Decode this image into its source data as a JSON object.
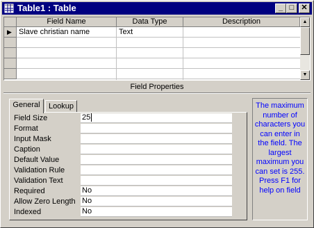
{
  "window": {
    "title": "Table1 : Table",
    "icon": "table-icon",
    "buttons": {
      "minimize": "_",
      "maximize": "□",
      "close": "✕"
    }
  },
  "grid": {
    "columns": [
      "Field Name",
      "Data Type",
      "Description"
    ],
    "rows": [
      {
        "field_name": "Slave christian name",
        "data_type": "Text",
        "description": ""
      }
    ],
    "current_row_indicator": "▶"
  },
  "field_properties": {
    "heading": "Field Properties",
    "tabs": [
      "General",
      "Lookup"
    ],
    "active_tab": "General",
    "properties": [
      {
        "label": "Field Size",
        "value": "25"
      },
      {
        "label": "Format",
        "value": ""
      },
      {
        "label": "Input Mask",
        "value": ""
      },
      {
        "label": "Caption",
        "value": ""
      },
      {
        "label": "Default Value",
        "value": ""
      },
      {
        "label": "Validation Rule",
        "value": ""
      },
      {
        "label": "Validation Text",
        "value": ""
      },
      {
        "label": "Required",
        "value": "No"
      },
      {
        "label": "Allow Zero Length",
        "value": "No"
      },
      {
        "label": "Indexed",
        "value": "No"
      }
    ],
    "help_text": "The maximum number of characters you can enter in the field.  The largest maximum you can set is 255.  Press F1 for help on field",
    "help_color": "#0000ff"
  },
  "colors": {
    "titlebar": "#000080",
    "face": "#d4d0c8"
  }
}
